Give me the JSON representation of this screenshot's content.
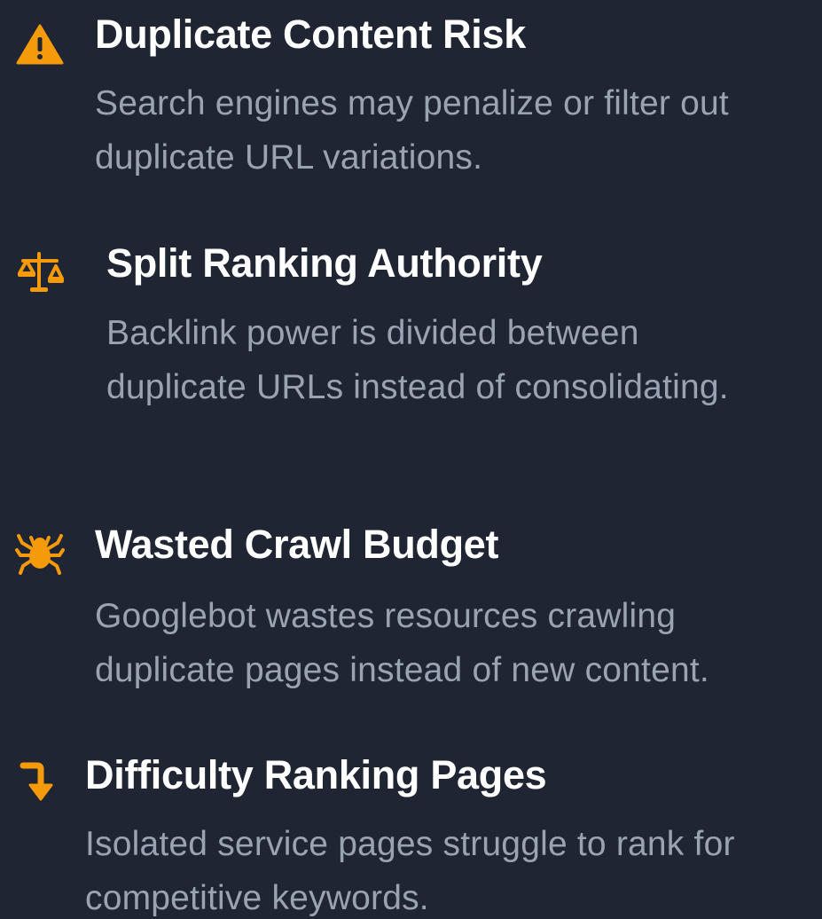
{
  "accent_color": "#f59a0b",
  "items": [
    {
      "icon": "warning-triangle-icon",
      "title": "Duplicate Content Risk",
      "description": "Search engines may penalize or filter out duplicate URL variations."
    },
    {
      "icon": "balance-scale-icon",
      "title": "Split Ranking Authority",
      "description": "Backlink power is divided between duplicate URLs instead of consolidating."
    },
    {
      "icon": "spider-icon",
      "title": "Wasted Crawl Budget",
      "description": "Googlebot wastes resources crawling duplicate pages instead of new content."
    },
    {
      "icon": "arrow-turn-down-icon",
      "title": "Difficulty Ranking Pages",
      "description": "Isolated service pages struggle to rank for competitive keywords."
    }
  ]
}
